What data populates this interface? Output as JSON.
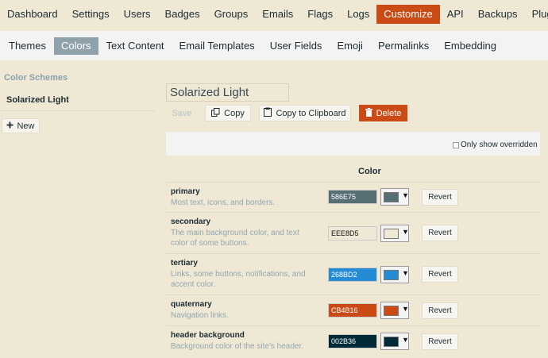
{
  "top_nav": {
    "items": [
      {
        "label": "Dashboard"
      },
      {
        "label": "Settings"
      },
      {
        "label": "Users"
      },
      {
        "label": "Badges"
      },
      {
        "label": "Groups"
      },
      {
        "label": "Emails"
      },
      {
        "label": "Flags"
      },
      {
        "label": "Logs"
      },
      {
        "label": "Customize"
      },
      {
        "label": "API"
      },
      {
        "label": "Backups"
      },
      {
        "label": "Plugins"
      }
    ],
    "active": "Customize",
    "accent_color": "#cb4b16"
  },
  "sub_nav": {
    "items": [
      {
        "label": "Themes"
      },
      {
        "label": "Colors"
      },
      {
        "label": "Text Content"
      },
      {
        "label": "Email Templates"
      },
      {
        "label": "User Fields"
      },
      {
        "label": "Emoji"
      },
      {
        "label": "Permalinks"
      },
      {
        "label": "Embedding"
      }
    ],
    "active": "Colors"
  },
  "sidebar": {
    "heading": "Color Schemes",
    "schemes": [
      {
        "label": "Solarized Light"
      }
    ],
    "new_label": "New",
    "new_icon": "plus-icon"
  },
  "editor": {
    "scheme_name_value": "Solarized Light",
    "save_label": "Save",
    "copy_label": "Copy",
    "copy_icon": "copy-icon",
    "clipboard_label": "Copy to Clipboard",
    "clipboard_icon": "clipboard-icon",
    "delete_label": "Delete",
    "delete_icon": "trash-icon",
    "filter_label": "Only show overridden",
    "filter_checked": false,
    "column_header": "Color",
    "revert_label": "Revert",
    "rows": [
      {
        "name": "primary",
        "desc": "Most text, icons, and borders.",
        "hex": "586E75",
        "color": "#586e75"
      },
      {
        "name": "secondary",
        "desc": "The main background color, and text color of some buttons.",
        "hex": "EEE8D5",
        "color": "#eee8d5"
      },
      {
        "name": "tertiary",
        "desc": "Links, some buttons, notifications, and accent color.",
        "hex": "268BD2",
        "color": "#268bd2"
      },
      {
        "name": "quaternary",
        "desc": "Navigation links.",
        "hex": "CB4B16",
        "color": "#cb4b16"
      },
      {
        "name": "header background",
        "desc": "Background color of the site's header.",
        "hex": "002B36",
        "color": "#002b36"
      }
    ]
  }
}
